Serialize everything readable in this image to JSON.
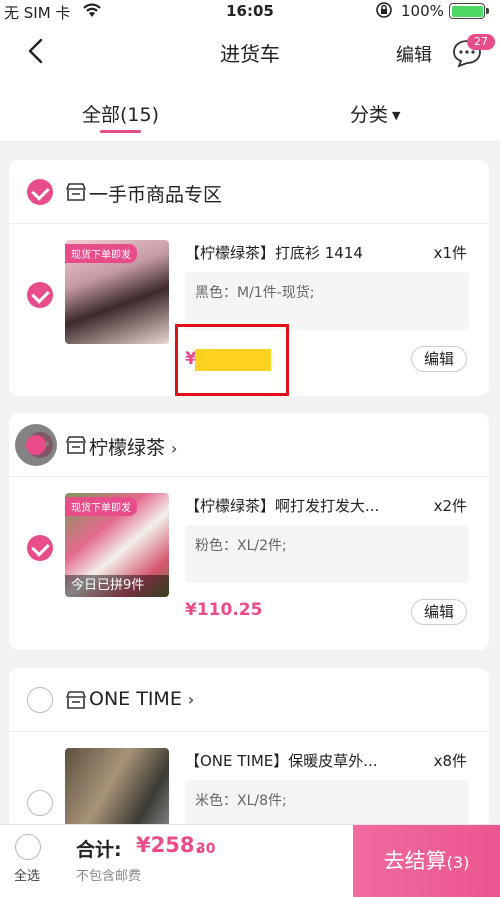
{
  "status_bar": {
    "carrier": "无 SIM 卡",
    "time": "16:05",
    "battery_pct": "100%"
  },
  "nav": {
    "title": "进货车",
    "edit_label": "编辑",
    "message_badge": "27"
  },
  "tabs": {
    "all_label": "全部(15)",
    "category_label": "分类"
  },
  "shops": [
    {
      "name": "一手币商品专区",
      "checked": true,
      "item": {
        "checked": true,
        "thumb_tag": "现货下单即发",
        "title": "【柠檬绿茶】打底衫 1414",
        "qty": "x1件",
        "spec": "黑色：M/1件-现货;",
        "price_visible_prefix": "¥",
        "edit_label": "编辑"
      }
    },
    {
      "name": "柠檬绿茶",
      "chevron": "›",
      "checked": true,
      "item": {
        "checked": true,
        "thumb_tag": "现货下单即发",
        "thumb_strip": "今日已拼9件",
        "title": "【柠檬绿茶】啊打发打发大...",
        "qty": "x2件",
        "spec": "粉色：XL/2件;",
        "price": "¥110.25",
        "edit_label": "编辑"
      }
    },
    {
      "name": "ONE TIME",
      "chevron": "›",
      "checked": false,
      "item": {
        "checked": false,
        "title": "【ONE TIME】保暖皮草外...",
        "qty": "x8件",
        "spec": "米色：XL/8件;"
      }
    }
  ],
  "bottom": {
    "select_all": "全选",
    "total_label": "合计:",
    "total_main": "¥258.",
    "total_cents": "30",
    "shipping_note": "不包含邮费",
    "checkout_label": "去结算",
    "checkout_count": "(3)"
  },
  "colors": {
    "accent": "#e94c8a",
    "annotation": "#e0101a",
    "redaction": "#ffd21f"
  }
}
